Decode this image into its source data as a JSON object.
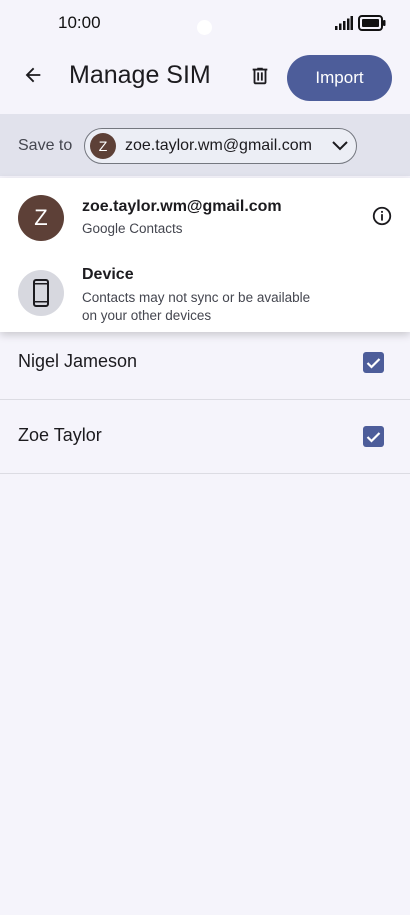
{
  "status_bar": {
    "time": "10:00"
  },
  "app_bar": {
    "title": "Manage SIM",
    "back_icon": "arrow-left-icon",
    "delete_icon": "trash-icon",
    "import_label": "Import"
  },
  "save_to": {
    "label": "Save to",
    "avatar_letter": "Z",
    "selected_account": "zoe.taylor.wm@gmail.com"
  },
  "dropdown": {
    "options": [
      {
        "avatar_letter": "Z",
        "title": "zoe.taylor.wm@gmail.com",
        "subtitle": "Google Contacts",
        "icon": "info-icon"
      },
      {
        "icon": "phone-icon",
        "title": "Device",
        "subtitle_line1": "Contacts may not sync or be available",
        "subtitle_line2": "on your other devices"
      }
    ]
  },
  "contacts": [
    {
      "name": "Nigel Jameson",
      "checked": true
    },
    {
      "name": "Zoe Taylor",
      "checked": true
    }
  ],
  "colors": {
    "primary": "#4d5d9a",
    "avatar": "#5d4037",
    "background": "#f5f4fb",
    "save_bar": "#e1e2ec"
  }
}
